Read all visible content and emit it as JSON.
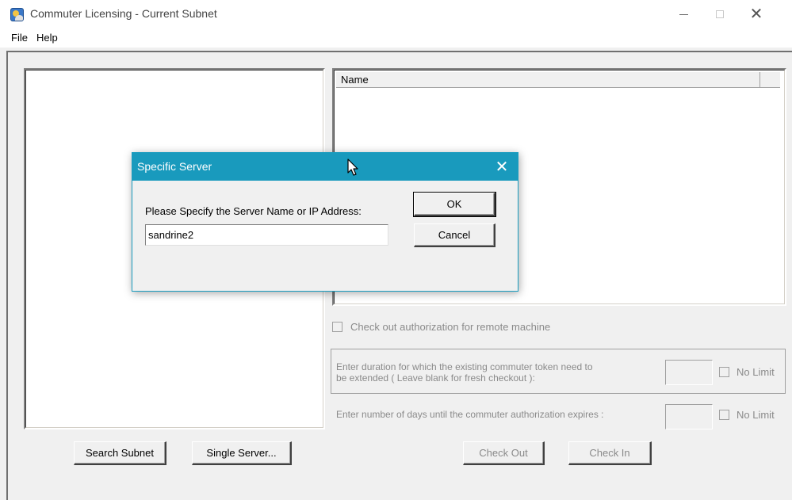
{
  "window": {
    "title": "Commuter Licensing - Current Subnet",
    "icon": "globe-app-icon"
  },
  "menu": {
    "items": [
      {
        "label": "File"
      },
      {
        "label": "Help"
      }
    ]
  },
  "server_list": {
    "items": []
  },
  "license_list": {
    "columns": [
      "Name"
    ],
    "rows": []
  },
  "remote_checkout": {
    "label": "Check out authorization for remote machine",
    "checked": false,
    "enabled": false
  },
  "extend_duration": {
    "label_line1": "Enter duration for which the existing commuter token need to",
    "label_line2": "be extended ( Leave blank for fresh checkout ):",
    "value": "",
    "no_limit_label": "No Limit"
  },
  "expire_days": {
    "label": "Enter number of days until the commuter authorization expires :",
    "value": "",
    "no_limit_label": "No Limit"
  },
  "buttons": {
    "search_subnet": "Search Subnet",
    "single_server": "Single Server...",
    "check_out": "Check Out",
    "check_in": "Check In"
  },
  "dialog": {
    "title": "Specific Server",
    "prompt": "Please Specify the Server Name or IP Address:",
    "server_value": "sandrine2",
    "ok_label": "OK",
    "cancel_label": "Cancel"
  }
}
